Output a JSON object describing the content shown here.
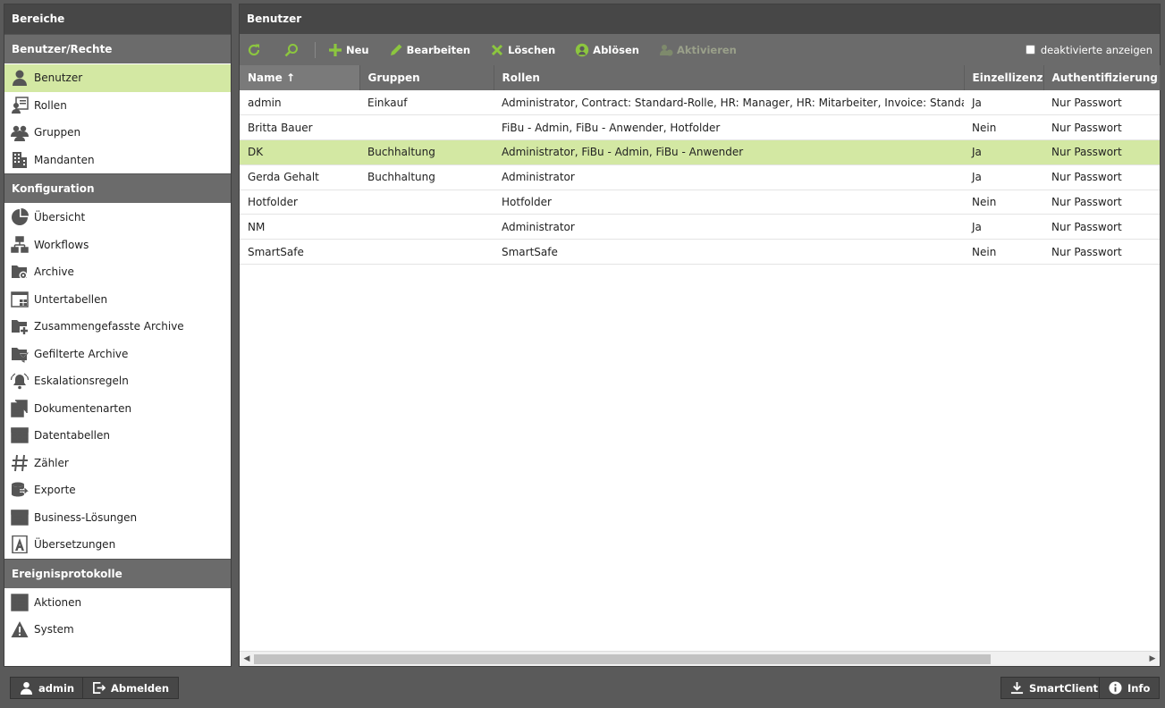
{
  "sidebar": {
    "title": "Bereiche",
    "groups": [
      {
        "label": "Benutzer/Rechte",
        "items": [
          {
            "label": "Benutzer",
            "icon": "user-icon",
            "active": true
          },
          {
            "label": "Rollen",
            "icon": "roles-icon"
          },
          {
            "label": "Gruppen",
            "icon": "group-icon"
          },
          {
            "label": "Mandanten",
            "icon": "building-icon"
          }
        ]
      },
      {
        "label": "Konfiguration",
        "items": [
          {
            "label": "Übersicht",
            "icon": "pie-chart-icon"
          },
          {
            "label": "Workflows",
            "icon": "workflow-icon"
          },
          {
            "label": "Archive",
            "icon": "folder-gear-icon"
          },
          {
            "label": "Untertabellen",
            "icon": "subtable-icon"
          },
          {
            "label": "Zusammengefasste Archive",
            "icon": "folder-plus-icon"
          },
          {
            "label": "Gefilterte Archive",
            "icon": "folder-filter-icon"
          },
          {
            "label": "Eskalationsregeln",
            "icon": "bell-icon"
          },
          {
            "label": "Dokumentenarten",
            "icon": "document-types-icon"
          },
          {
            "label": "Datentabellen",
            "icon": "table-icon"
          },
          {
            "label": "Zähler",
            "icon": "hash-icon"
          },
          {
            "label": "Exporte",
            "icon": "export-icon"
          },
          {
            "label": "Business-Lösungen",
            "icon": "business-icon"
          },
          {
            "label": "Übersetzungen",
            "icon": "translate-icon"
          }
        ]
      },
      {
        "label": "Ereignisprotokolle",
        "items": [
          {
            "label": "Aktionen",
            "icon": "list-icon"
          },
          {
            "label": "System",
            "icon": "warning-icon"
          }
        ]
      }
    ]
  },
  "main": {
    "title": "Benutzer",
    "toolbar": {
      "refresh_icon": "refresh-icon",
      "search_icon": "search-icon",
      "new_label": "Neu",
      "edit_label": "Bearbeiten",
      "delete_label": "Löschen",
      "replace_label": "Ablösen",
      "activate_label": "Aktivieren",
      "show_deactivated_label": "deaktivierte anzeigen",
      "show_deactivated_checked": false
    },
    "columns": [
      "Name",
      "Gruppen",
      "Rollen",
      "Einzellizenz",
      "Authentifizierung"
    ],
    "sort_indicator": "↑",
    "rows": [
      {
        "name": "admin",
        "groups": "Einkauf",
        "roles": "Administrator, Contract: Standard-Rolle, HR: Manager, HR: Mitarbeiter, Invoice: Standard-Rolle",
        "license": "Ja",
        "auth": "Nur Passwort"
      },
      {
        "name": "Britta Bauer",
        "groups": "",
        "roles": "FiBu - Admin, FiBu - Anwender, Hotfolder",
        "license": "Nein",
        "auth": "Nur Passwort"
      },
      {
        "name": "DK",
        "groups": "Buchhaltung",
        "roles": "Administrator, FiBu - Admin, FiBu - Anwender",
        "license": "Ja",
        "auth": "Nur Passwort",
        "selected": true
      },
      {
        "name": "Gerda Gehalt",
        "groups": "Buchhaltung",
        "roles": "Administrator",
        "license": "Ja",
        "auth": "Nur Passwort"
      },
      {
        "name": "Hotfolder",
        "groups": "",
        "roles": "Hotfolder",
        "license": "Nein",
        "auth": "Nur Passwort"
      },
      {
        "name": "NM",
        "groups": "",
        "roles": "Administrator",
        "license": "Ja",
        "auth": "Nur Passwort"
      },
      {
        "name": "SmartSafe",
        "groups": "",
        "roles": "SmartSafe",
        "license": "Nein",
        "auth": "Nur Passwort"
      }
    ]
  },
  "bottom": {
    "user_label": "admin",
    "logout_label": "Abmelden",
    "smartclient_label": "SmartClient",
    "info_label": "Info"
  },
  "colors": {
    "selection": "#d3e8a3",
    "header_dark": "#474747",
    "header_mid": "#6b6b6b",
    "accent_green": "#8cc63f"
  }
}
